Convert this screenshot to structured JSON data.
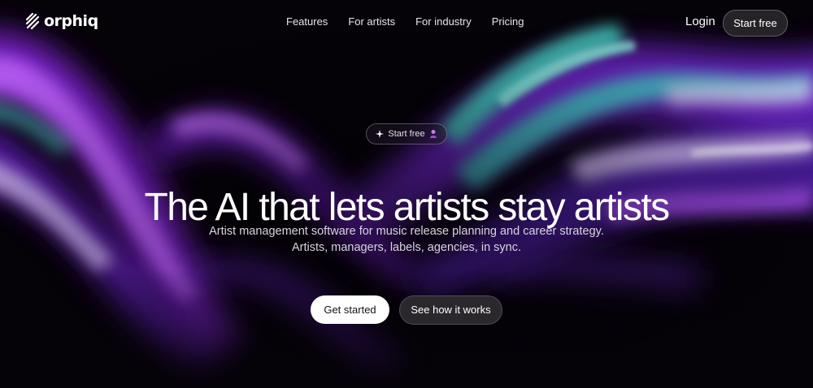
{
  "brand": {
    "name": "orphiq",
    "logo_icon": "orphiq-logo-icon"
  },
  "nav": {
    "links": [
      "Features",
      "For artists",
      "For industry",
      "Pricing"
    ],
    "login_label": "Login",
    "start_label": "Start free"
  },
  "hero": {
    "badge": {
      "label": "Start free",
      "leading_icon": "sparkle-icon",
      "trailing_icon": "avatar-icon"
    },
    "headline": "The AI that lets artists stay artists",
    "subline_1": "Artist management software for music release planning and career strategy.",
    "subline_2": "Artists, managers, labels, agencies, in sync.",
    "primary_cta": "Get started",
    "secondary_cta": "See how it works"
  },
  "colors": {
    "background": "#050208",
    "wave_purple": "#8a2bd6",
    "wave_teal": "#3fc9b8",
    "wave_lavender": "#c9b8e6",
    "primary_button": "#ffffff",
    "secondary_button": "#2c2a2e"
  }
}
